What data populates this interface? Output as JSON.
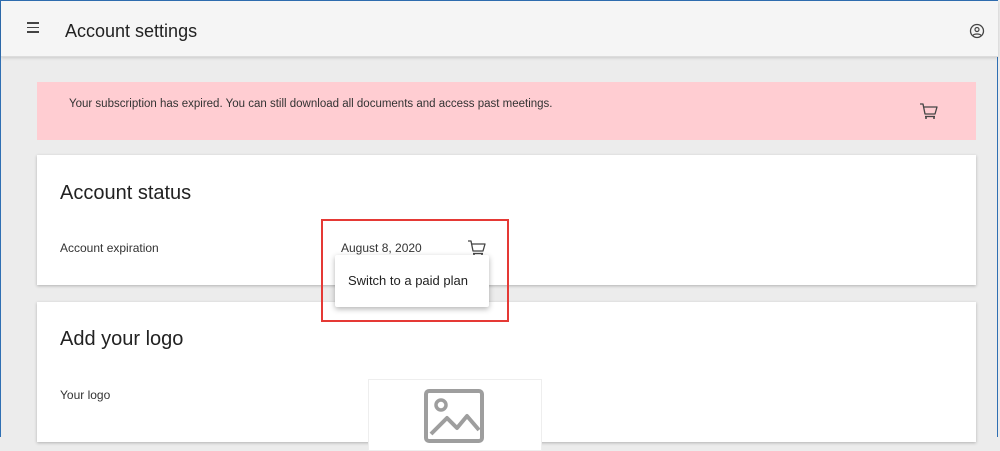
{
  "appbar": {
    "title": "Account settings",
    "menu_icon": "menu-icon",
    "account_icon": "account-circle-icon"
  },
  "banner": {
    "message": "Your subscription has expired. You can still download all documents and access past meetings.",
    "icon": "cart-icon",
    "background": "#ffcdd2"
  },
  "account_status": {
    "title": "Account status",
    "expiration_label": "Account expiration",
    "expiration_value": "August 8, 2020",
    "icon": "cart-icon",
    "tooltip": "Switch to a paid plan"
  },
  "logo_section": {
    "title": "Add your logo",
    "logo_label": "Your logo",
    "placeholder_icon": "image-icon"
  },
  "colors": {
    "highlight": "#e53935",
    "background": "#ececec"
  }
}
